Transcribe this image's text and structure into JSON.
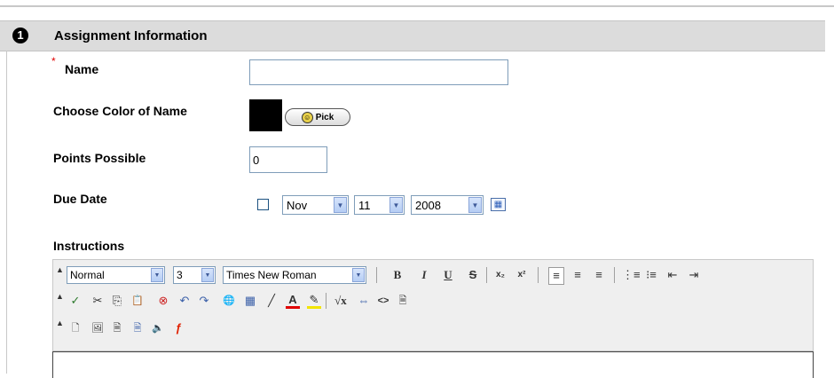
{
  "section": {
    "step": "1",
    "title": "Assignment Information"
  },
  "fields": {
    "required_mark": "*",
    "name_label": "Name",
    "name_value": "",
    "color_label": "Choose Color of Name",
    "color_value": "#000000",
    "pick_label": "Pick",
    "points_label": "Points Possible",
    "points_value": "0",
    "due_label": "Due Date",
    "due_month": "Nov",
    "due_day": "11",
    "due_year": "2008",
    "instructions_label": "Instructions"
  },
  "toolbar": {
    "format_select": "Normal",
    "size_select": "3",
    "font_select": "Times New Roman",
    "bold": "B",
    "italic": "I",
    "underline": "U",
    "strikethrough": "S",
    "subscript": "x₂",
    "superscript": "x²",
    "align_left": "≡",
    "align_center": "≡",
    "align_right": "≡",
    "numbered_list": "⋮≡",
    "bullet_list": "⁝≡",
    "outdent": "⇤",
    "indent": "⇥",
    "spellcheck": "✓",
    "cut": "✂",
    "copy": "⎘",
    "paste": "📋",
    "clear_format": "⊗",
    "undo": "↶",
    "redo": "↷",
    "link": "🌐",
    "table": "▦",
    "line": "╱",
    "text_color": "A",
    "highlight": "✎",
    "equation": "√x",
    "anchor": "⇔",
    "html_source": "<>",
    "preview": "🗎",
    "attach_file": "🗋",
    "image": "🖼",
    "media": "🗎",
    "link_doc": "🗎",
    "audio": "🔈",
    "flash": "ƒ"
  },
  "icons": {
    "row_handle": "▲",
    "calendar": "▦",
    "dropdown": "▼",
    "palette": "☺"
  }
}
